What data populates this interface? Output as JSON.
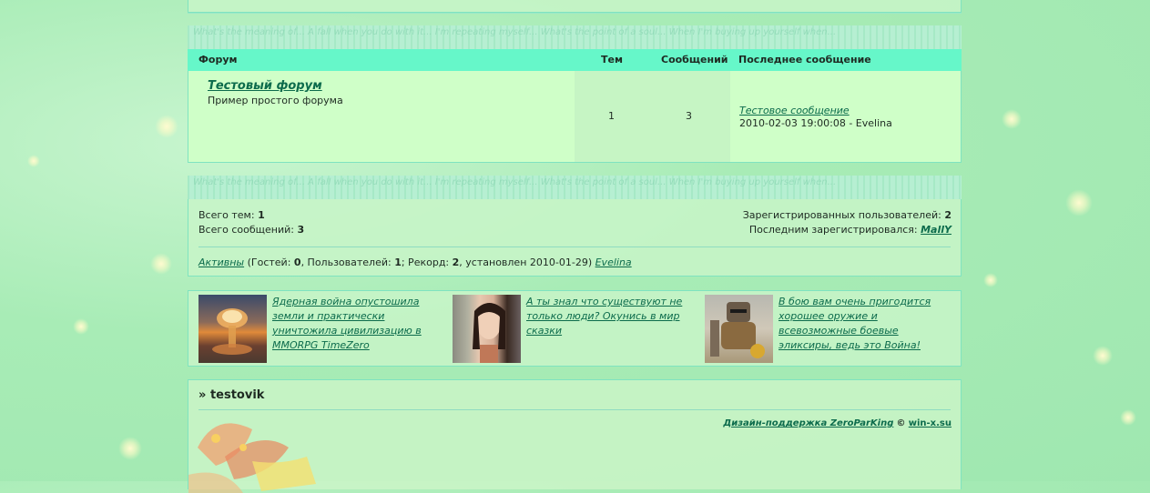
{
  "banner_text": "What's the meaning of... A fall when you do with it... I'm repeating myself... What's the point of a soul... When I'm buying up yourself when...",
  "forum_table": {
    "headers": [
      "Форум",
      "Тем",
      "Сообщений",
      "Последнее сообщение"
    ],
    "rows": [
      {
        "title": "Тестовый форум",
        "description": "Пример простого форума",
        "topics": "1",
        "posts": "3",
        "last_post_title": "Тестовое сообщение",
        "last_post_meta": "2010-02-03 19:00:08 - Evelina"
      }
    ]
  },
  "stats": {
    "topics_label": "Всего тем:",
    "topics_value": "1",
    "posts_label": "Всего сообщений:",
    "posts_value": "3",
    "registered_label": "Зарегистрированных пользователей:",
    "registered_value": "2",
    "last_registered_label": "Последним зарегистрировался:",
    "last_registered_user": "MallY",
    "active_link": "Активны",
    "guests_label": "(Гостей:",
    "guests_value": "0",
    "users_label": ", Пользователей:",
    "users_value": "1",
    "record_label": "; Рекорд:",
    "record_value": "2",
    "record_date": ", установлен 2010-01-29)",
    "active_user": "Evelina"
  },
  "ads": [
    {
      "text": "Ядерная война опустошила земли и практически уничтожила цивилизацию в MMORPG TimeZero",
      "image": "nuclear-explosion"
    },
    {
      "text": "А ты знал что существуют не только люди? Окунись в мир сказки",
      "image": "fantasy-girl"
    },
    {
      "text": "В бою вам очень пригодится хорошее оружие и всевозможные боевые эликсиры, ведь это Война!",
      "image": "armored-warrior"
    }
  ],
  "footer": {
    "username_prefix": "»",
    "username": "testovik",
    "credit_label": "Дизайн-поддержка ZeroParKing",
    "copyright": "©",
    "credit_site": "win-x.su"
  },
  "colors": {
    "accent": "#66f7c9",
    "row_bg": "#cfffc8",
    "link": "#0c6b4c"
  }
}
